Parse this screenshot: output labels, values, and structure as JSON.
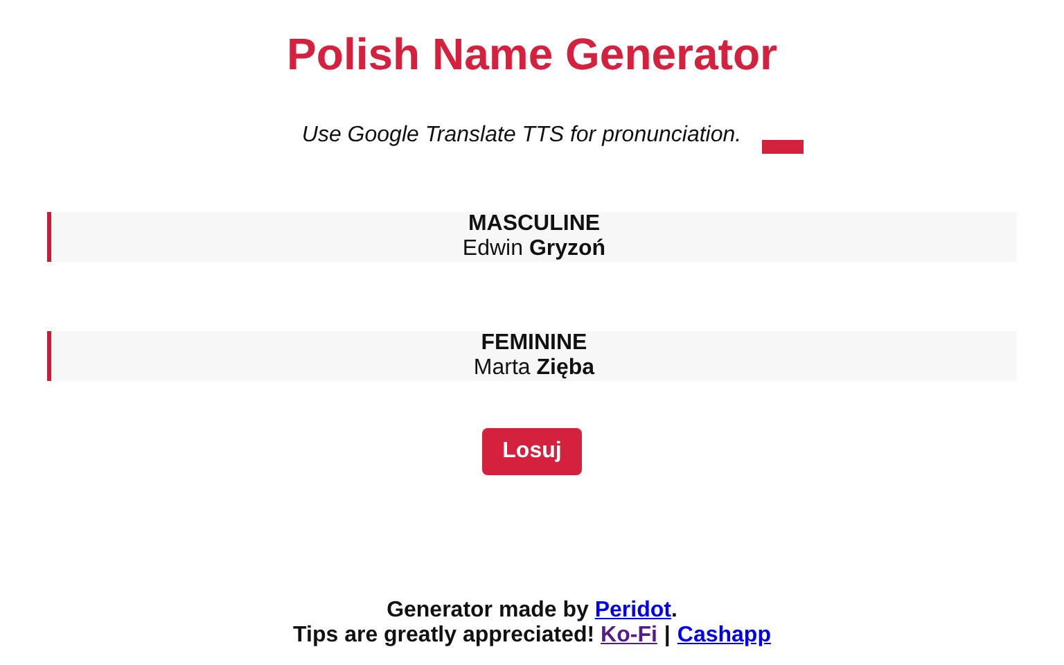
{
  "title": "Polish Name Generator",
  "subtitle": "Use Google Translate TTS for pronunciation.",
  "results": [
    {
      "heading": "MASCULINE",
      "name": "Edwin **Gryzoń**"
    },
    {
      "heading": "FEMININE",
      "name": "Marta **Zięba**"
    }
  ],
  "button": "Losuj",
  "footer": {
    "credit_text": "Generator made by ",
    "credit_link": "Peridot",
    "credit_end": ".",
    "tips_text": "Tips are greatly appreciated! ",
    "links": [
      {
        "label": "Ko-Fi",
        "visited": true
      },
      {
        "label": "Cashapp",
        "visited": false
      }
    ],
    "separator": "|"
  }
}
